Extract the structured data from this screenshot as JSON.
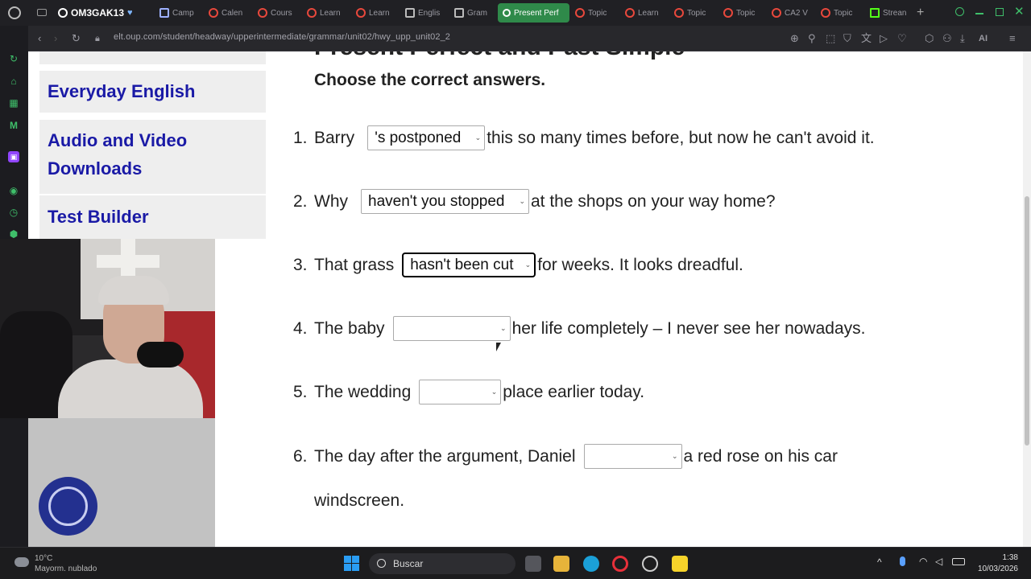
{
  "browser": {
    "tabs": [
      {
        "label": "OM3GAK13"
      },
      {
        "label": "Camp"
      },
      {
        "label": "Calen"
      },
      {
        "label": "Cours"
      },
      {
        "label": "Learn"
      },
      {
        "label": "Learn"
      },
      {
        "label": "Englis"
      },
      {
        "label": "Gram"
      },
      {
        "label": "Present Perf",
        "active": true
      },
      {
        "label": "Topic"
      },
      {
        "label": "Learn"
      },
      {
        "label": "Topic"
      },
      {
        "label": "Topic"
      },
      {
        "label": "CA2 V"
      },
      {
        "label": "Topic"
      },
      {
        "label": "Strean"
      }
    ],
    "url": "elt.oup.com/student/headway/upperintermediate/grammar/unit02/hwy_upp_unit02_2",
    "ai_label": "AI"
  },
  "sidebar_nav": {
    "items": [
      "Everyday English",
      "Audio and Video Downloads",
      "Test Builder"
    ]
  },
  "exercise": {
    "title": "Present Perfect and Past Simple",
    "instruction": "Choose the correct answers.",
    "questions": [
      {
        "num": "1.",
        "before": "Barry",
        "selected": "'s postponed",
        "after": "this so many times before, but now he can't avoid it."
      },
      {
        "num": "2.",
        "before": "Why",
        "selected": "haven't you stopped",
        "after": "at the shops on your way home?"
      },
      {
        "num": "3.",
        "before": "That grass",
        "selected": "hasn't been cut",
        "after": "for weeks. It looks dreadful."
      },
      {
        "num": "4.",
        "before": "The baby",
        "selected": "",
        "after": "her life completely – I never see her nowadays."
      },
      {
        "num": "5.",
        "before": "The wedding",
        "selected": "",
        "after": "place earlier today."
      },
      {
        "num": "6.",
        "before": "The day after the argument, Daniel",
        "selected": "",
        "after": "a red rose on his car",
        "after_line2": "windscreen."
      }
    ]
  },
  "taskbar": {
    "search_placeholder": "Buscar",
    "weather_temp": "10°C",
    "weather_desc": "Mayorm. nublado",
    "time": "1:38",
    "date": "10/03/2026"
  },
  "colors": {
    "link_blue": "#1a1aa6",
    "active_tab": "#2f8a4a",
    "opera_red": "#e8483c"
  }
}
